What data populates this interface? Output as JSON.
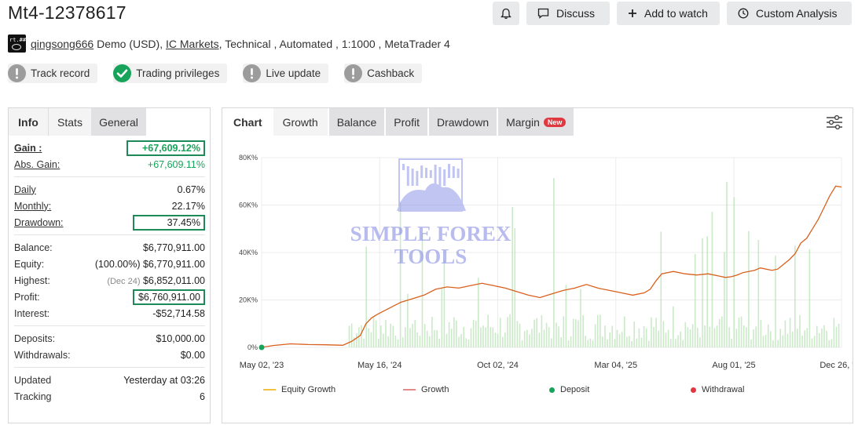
{
  "header": {
    "title": "Mt4-12378617",
    "buttons": {
      "discuss": "Discuss",
      "add_to_watch": "Add to watch",
      "custom_analysis": "Custom Analysis"
    }
  },
  "account": {
    "avatar_text": "rt.##",
    "user": "qingsong666",
    "type": "Demo (USD),",
    "broker": "IC Markets",
    "rest": ", Technical , Automated , 1:1000 , MetaTrader 4"
  },
  "badges": [
    {
      "label": "Track record",
      "status": "grey"
    },
    {
      "label": "Trading privileges",
      "status": "green"
    },
    {
      "label": "Live update",
      "status": "grey"
    },
    {
      "label": "Cashback",
      "status": "grey"
    }
  ],
  "left_tabs": {
    "info": "Info",
    "stats": "Stats",
    "general": "General"
  },
  "stats": {
    "gain_label": "Gain :",
    "gain": "+67,609.12%",
    "abs_gain_label": "Abs. Gain:",
    "abs_gain": "+67,609.11%",
    "daily_label": "Daily",
    "daily": "0.67%",
    "monthly_label": "Monthly:",
    "monthly": "22.17%",
    "drawdown_label": "Drawdown:",
    "drawdown": "37.45%",
    "balance_label": "Balance:",
    "balance": "$6,770,911.00",
    "equity_label": "Equity:",
    "equity_pct": "(100.00%)",
    "equity": "$6,770,911.00",
    "highest_label": "Highest:",
    "highest_date": "(Dec 24)",
    "highest": "$6,852,011.00",
    "profit_label": "Profit:",
    "profit": "$6,760,911.00",
    "interest_label": "Interest:",
    "interest": "-$52,714.58",
    "deposits_label": "Deposits:",
    "deposits": "$10,000.00",
    "withdrawals_label": "Withdrawals:",
    "withdrawals": "$0.00",
    "updated_label": "Updated",
    "updated": "Yesterday at 03:26",
    "tracking_label": "Tracking",
    "tracking": "6"
  },
  "right_tabs": {
    "chart": "Chart",
    "growth": "Growth",
    "balance": "Balance",
    "profit": "Profit",
    "drawdown": "Drawdown",
    "margin": "Margin",
    "new": "New"
  },
  "watermark": {
    "line1": "SIMPLE FOREX",
    "line2": "TOOLS"
  },
  "colors": {
    "green": "#18a35a",
    "growth_line": "#d9601c",
    "bars": "#b9e3b5",
    "equity_line": "#f0c040",
    "withdrawal": "#e0383e"
  },
  "chart_data": {
    "type": "line",
    "y_ticks": [
      "0%",
      "20K%",
      "40K%",
      "60K%",
      "80K%"
    ],
    "ylim": [
      0,
      80000
    ],
    "x_ticks": [
      "May 02, '23",
      "May 16, '24",
      "Oct 02, '24",
      "Mar 04, '25",
      "Aug 01, '25",
      "Dec 26, '25"
    ],
    "x_tick_pos": [
      0,
      0.2036,
      0.4072,
      0.6108,
      0.8144,
      1.0
    ],
    "growth": [
      [
        0,
        0
      ],
      [
        0.02,
        800
      ],
      [
        0.05,
        1500
      ],
      [
        0.08,
        1200
      ],
      [
        0.11,
        1100
      ],
      [
        0.14,
        900
      ],
      [
        0.155,
        2500
      ],
      [
        0.17,
        5000
      ],
      [
        0.18,
        10000
      ],
      [
        0.19,
        12500
      ],
      [
        0.2,
        14000
      ],
      [
        0.22,
        16500
      ],
      [
        0.24,
        19000
      ],
      [
        0.26,
        20500
      ],
      [
        0.28,
        22000
      ],
      [
        0.3,
        24500
      ],
      [
        0.32,
        25500
      ],
      [
        0.34,
        25000
      ],
      [
        0.36,
        26000
      ],
      [
        0.38,
        27000
      ],
      [
        0.4,
        26000
      ],
      [
        0.42,
        25000
      ],
      [
        0.44,
        23500
      ],
      [
        0.46,
        22000
      ],
      [
        0.48,
        21000
      ],
      [
        0.5,
        22500
      ],
      [
        0.52,
        24000
      ],
      [
        0.54,
        25000
      ],
      [
        0.56,
        26500
      ],
      [
        0.58,
        25000
      ],
      [
        0.6,
        24000
      ],
      [
        0.62,
        23000
      ],
      [
        0.64,
        22000
      ],
      [
        0.66,
        23000
      ],
      [
        0.67,
        24500
      ],
      [
        0.68,
        28000
      ],
      [
        0.69,
        31000
      ],
      [
        0.71,
        32000
      ],
      [
        0.73,
        31000
      ],
      [
        0.75,
        30500
      ],
      [
        0.77,
        31000
      ],
      [
        0.79,
        30000
      ],
      [
        0.8,
        29500
      ],
      [
        0.81,
        29800
      ],
      [
        0.82,
        30500
      ],
      [
        0.83,
        31500
      ],
      [
        0.85,
        32500
      ],
      [
        0.86,
        33500
      ],
      [
        0.88,
        32500
      ],
      [
        0.89,
        33000
      ],
      [
        0.9,
        35000
      ],
      [
        0.91,
        37000
      ],
      [
        0.92,
        39500
      ],
      [
        0.93,
        44000
      ],
      [
        0.94,
        46000
      ],
      [
        0.95,
        50000
      ],
      [
        0.96,
        54000
      ],
      [
        0.97,
        59000
      ],
      [
        0.98,
        64000
      ],
      [
        0.99,
        68000
      ],
      [
        1.0,
        67609
      ]
    ],
    "legend": [
      {
        "name": "Equity Growth",
        "kind": "line",
        "color": "#f0c040"
      },
      {
        "name": "Growth",
        "kind": "line",
        "color": "#d9601c"
      },
      {
        "name": "Deposit",
        "kind": "dot",
        "color": "#18a35a"
      },
      {
        "name": "Withdrawal",
        "kind": "dot",
        "color": "#e0383e"
      }
    ]
  }
}
